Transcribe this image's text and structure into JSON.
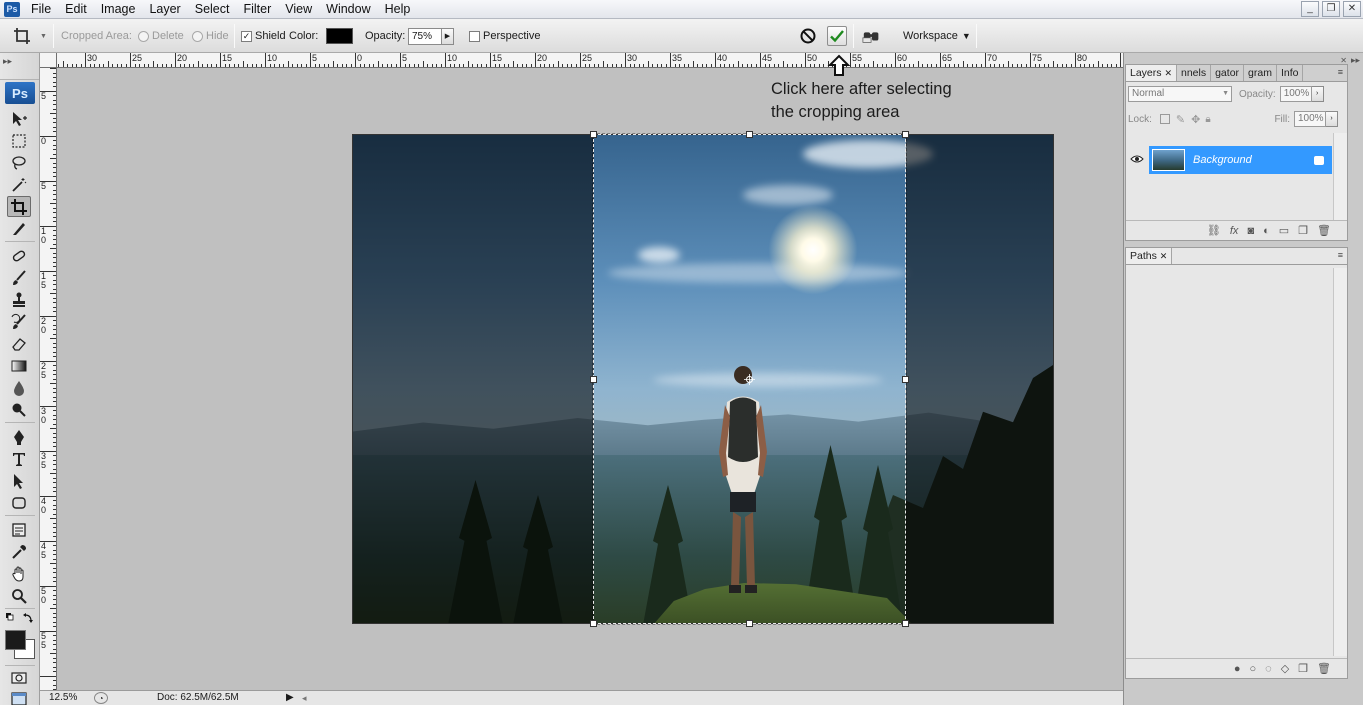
{
  "menubar": {
    "items": [
      "File",
      "Edit",
      "Image",
      "Layer",
      "Select",
      "Filter",
      "View",
      "Window",
      "Help"
    ],
    "window_controls": [
      "_",
      "❐",
      "✕"
    ]
  },
  "options": {
    "cropped_area_label": "Cropped Area:",
    "delete_label": "Delete",
    "hide_label": "Hide",
    "shield_label": "Shield",
    "shield_checked": true,
    "color_label": "Color:",
    "shield_color": "#000000",
    "opacity_label": "Opacity:",
    "opacity_value": "75%",
    "perspective_label": "Perspective",
    "perspective_checked": false,
    "workspace_label": "Workspace"
  },
  "annotation": {
    "line1": "Click here after selecting",
    "line2": "the cropping area"
  },
  "rulers": {
    "h_labels": [
      "30",
      "25",
      "20",
      "15",
      "10",
      "5",
      "0",
      "5",
      "10",
      "15",
      "20",
      "25",
      "30",
      "35",
      "40",
      "45",
      "50",
      "55",
      "60",
      "65",
      "70",
      "75",
      "80"
    ],
    "v_labels": [
      "5",
      "0",
      "5",
      "1 0",
      "1 5",
      "2 0",
      "2 5",
      "3 0",
      "3 5",
      "4 0",
      "4 5",
      "5 0",
      "5 5"
    ]
  },
  "layers_panel": {
    "tabs": [
      "Layers",
      "nnels",
      "gator",
      "gram",
      "Info"
    ],
    "blend_mode": "Normal",
    "opacity_label": "Opacity:",
    "opacity_value": "100%",
    "lock_label": "Lock:",
    "fill_label": "Fill:",
    "fill_value": "100%",
    "layer_name": "Background",
    "footer_icons": [
      "link-icon",
      "fx-icon",
      "mask-icon",
      "adjustment-icon",
      "folder-icon",
      "new-layer-icon",
      "trash-icon"
    ]
  },
  "paths_panel": {
    "tab": "Paths"
  },
  "statusbar": {
    "zoom": "12.5%",
    "doc": "Doc: 62.5M/62.5M"
  },
  "colors": {
    "accent": "#3399ff",
    "foreground": "#1a1a1a",
    "background": "#ffffff"
  }
}
